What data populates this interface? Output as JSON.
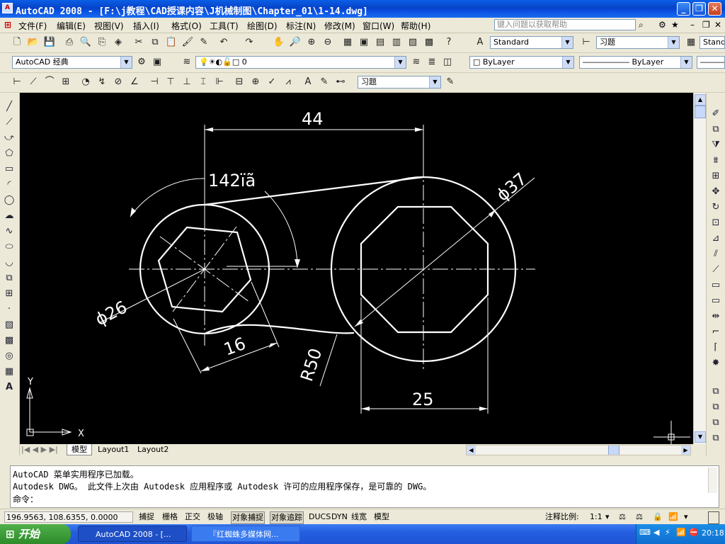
{
  "titlebar": {
    "app_icon": "autocad-icon",
    "title": "AutoCAD 2008 - [F:\\j教程\\CAD授课内容\\J机械制图\\Chapter_01\\1-14.dwg]",
    "buttons": [
      "minimize-icon",
      "restore-icon",
      "close-icon"
    ]
  },
  "menubar": {
    "items": [
      "文件(F)",
      "编辑(E)",
      "视图(V)",
      "插入(I)",
      "格式(O)",
      "工具(T)",
      "绘图(D)",
      "标注(N)",
      "修改(M)",
      "窗口(W)",
      "帮助(H)"
    ],
    "help_placeholder": "键入问题以获取帮助"
  },
  "toolbar": {
    "text_style": "Standard",
    "dim_style": "习题",
    "dim_style2": "Stand",
    "workspace": "AutoCAD 经典",
    "layer": "0",
    "color": "ByLayer",
    "linetype": "ByLayer",
    "dim_style3": "习题"
  },
  "drawing": {
    "dims": {
      "width_top": "44",
      "angle": "142ïã",
      "dia_large": "ϕ37",
      "dia_small": "ϕ26",
      "dist_16": "16",
      "radius": "R50",
      "width_bottom": "25"
    },
    "ucs": {
      "x": "X",
      "y": "Y"
    }
  },
  "tabs": {
    "model": "模型",
    "layout1": "Layout1",
    "layout2": "Layout2"
  },
  "command": {
    "line1": "AutoCAD 菜单实用程序已加载。",
    "line2": "Autodesk DWG。  此文件上次由 Autodesk 应用程序或 Autodesk 许可的应用程序保存，是可靠的 DWG。",
    "prompt": "命令："
  },
  "status": {
    "coords": "196.9563, 108.6355, 0.0000",
    "buttons": [
      "捕捉",
      "栅格",
      "正交",
      "极轴",
      "对象捕捉",
      "对象追踪",
      "DUCS",
      "DYN",
      "线宽",
      "模型"
    ],
    "anno_label": "注释比例:",
    "anno_value": "1:1"
  },
  "taskbar": {
    "start": "开始",
    "tasks": [
      "AutoCAD 2008 - [...",
      "『红蜘蛛多媒体网..."
    ],
    "clock": "20:18"
  },
  "colors": {
    "canvas": "#000000",
    "lines": "#ffffff",
    "titlebar": "#0a5fe6"
  }
}
